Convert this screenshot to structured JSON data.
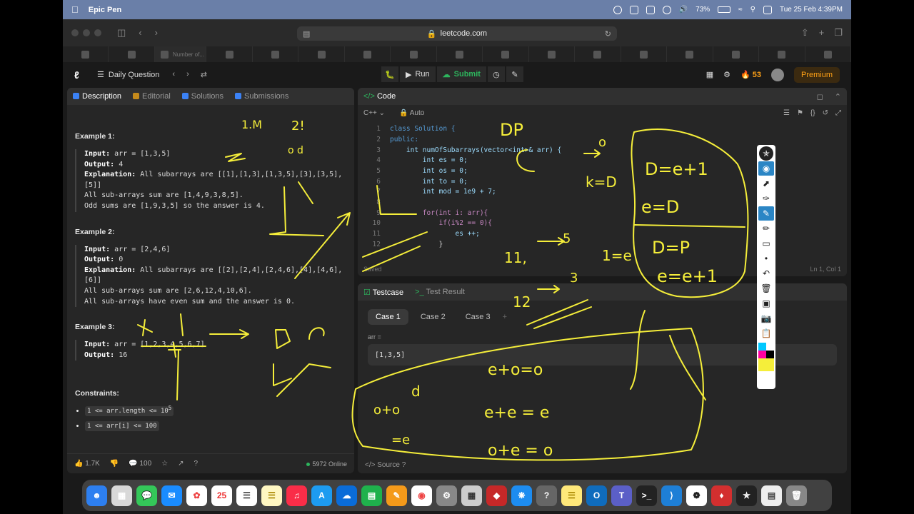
{
  "menubar": {
    "app_name": "Epic Pen",
    "battery": "73%",
    "datetime": "Tue 25 Feb  4:39PM"
  },
  "browser": {
    "url": "leetcode.com",
    "active_tab": "Number of..."
  },
  "nav": {
    "title": "Daily Question",
    "run": "Run",
    "submit": "Submit",
    "streak": "53",
    "premium": "Premium"
  },
  "desc_tabs": {
    "description": "Description",
    "editorial": "Editorial",
    "solutions": "Solutions",
    "submissions": "Submissions"
  },
  "examples": [
    {
      "title": "Example 1:",
      "input": "arr = [1,3,5]",
      "output": "4",
      "explanation": "All subarrays are [[1],[1,3],[1,3,5],[3],[3,5],[5]]",
      "extra": [
        "All sub-arrays sum are [1,4,9,3,8,5].",
        "Odd sums are [1,9,3,5] so the answer is 4."
      ]
    },
    {
      "title": "Example 2:",
      "input": "arr = [2,4,6]",
      "output": "0",
      "explanation": "All subarrays are [[2],[2,4],[2,4,6],[4],[4,6],[6]]",
      "extra": [
        "All sub-arrays sum are [2,6,12,4,10,6].",
        "All sub-arrays have even sum and the answer is 0."
      ]
    },
    {
      "title": "Example 3:",
      "input": "arr = [1,2,3,4,5,6,7]",
      "output": "16"
    }
  ],
  "labels": {
    "input": "Input:",
    "output": "Output:",
    "explanation": "Explanation:",
    "constraints": "Constraints:"
  },
  "constraints": [
    "1 <= arr.length <= 10",
    "1 <= arr[i] <= 100"
  ],
  "constraint_sup": "5",
  "desc_footer": {
    "likes": "1.7K",
    "comments": "100",
    "online": "5972 Online"
  },
  "code_panel": {
    "title": "Code",
    "language": "C++",
    "mode": "Auto",
    "saved": "Saved",
    "cursor": "Ln 1, Col 1",
    "lines": [
      "class Solution {",
      "public:",
      "    int numOfSubarrays(vector<int>& arr) {",
      "        int es = 0;",
      "        int os = 0;",
      "        int to = 0;",
      "        int mod = 1e9 + 7;",
      "",
      "        for(int i: arr){",
      "            if(i%2 == 0){",
      "                es ++;",
      "            }"
    ]
  },
  "test_panel": {
    "testcase": "Testcase",
    "result": "Test Result",
    "cases": [
      "Case 1",
      "Case 2",
      "Case 3"
    ],
    "arr_label": "arr =",
    "arr_value": "[1,3,5]",
    "source": "Source"
  },
  "ink_colors": {
    "pen": "#f5ee3a"
  },
  "colors": {
    "accent": "#ffa116",
    "success": "#2db55d"
  }
}
